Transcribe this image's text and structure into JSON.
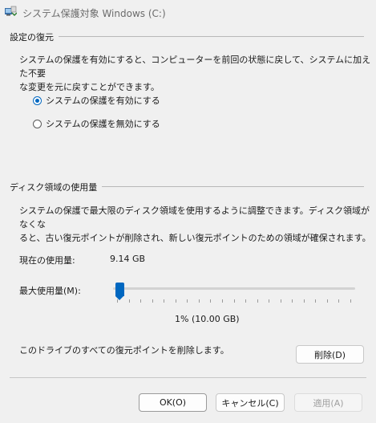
{
  "window": {
    "title": "システム保護対象 Windows (C:)"
  },
  "restore_settings": {
    "group_label": "設定の復元",
    "description_line1": "システムの保護を有効にすると、コンピューターを前回の状態に戻して、システムに加えた不要",
    "description_line2": "な変更を元に戻すことができます。",
    "options": [
      {
        "label": "システムの保護を有効にする",
        "checked": true
      },
      {
        "label": "システムの保護を無効にする",
        "checked": false
      }
    ]
  },
  "disk_usage": {
    "group_label": "ディスク領域の使用量",
    "description_line1": "システムの保護で最大限のディスク領域を使用するように調整できます。ディスク領域がなくな",
    "description_line2": "ると、古い復元ポイントが削除され、新しい復元ポイントのための領域が確保されます。",
    "current_label": "現在の使用量:",
    "current_value": "9.14 GB",
    "max_label": "最大使用量(M):",
    "max_percent": 1,
    "max_value_text": "1% (10.00 GB)",
    "delete_text": "このドライブのすべての復元ポイントを削除します。",
    "delete_button": "削除(D)"
  },
  "footer": {
    "ok": "OK(O)",
    "cancel": "キャンセル(C)",
    "apply": "適用(A)"
  },
  "colors": {
    "accent": "#0067c0"
  }
}
